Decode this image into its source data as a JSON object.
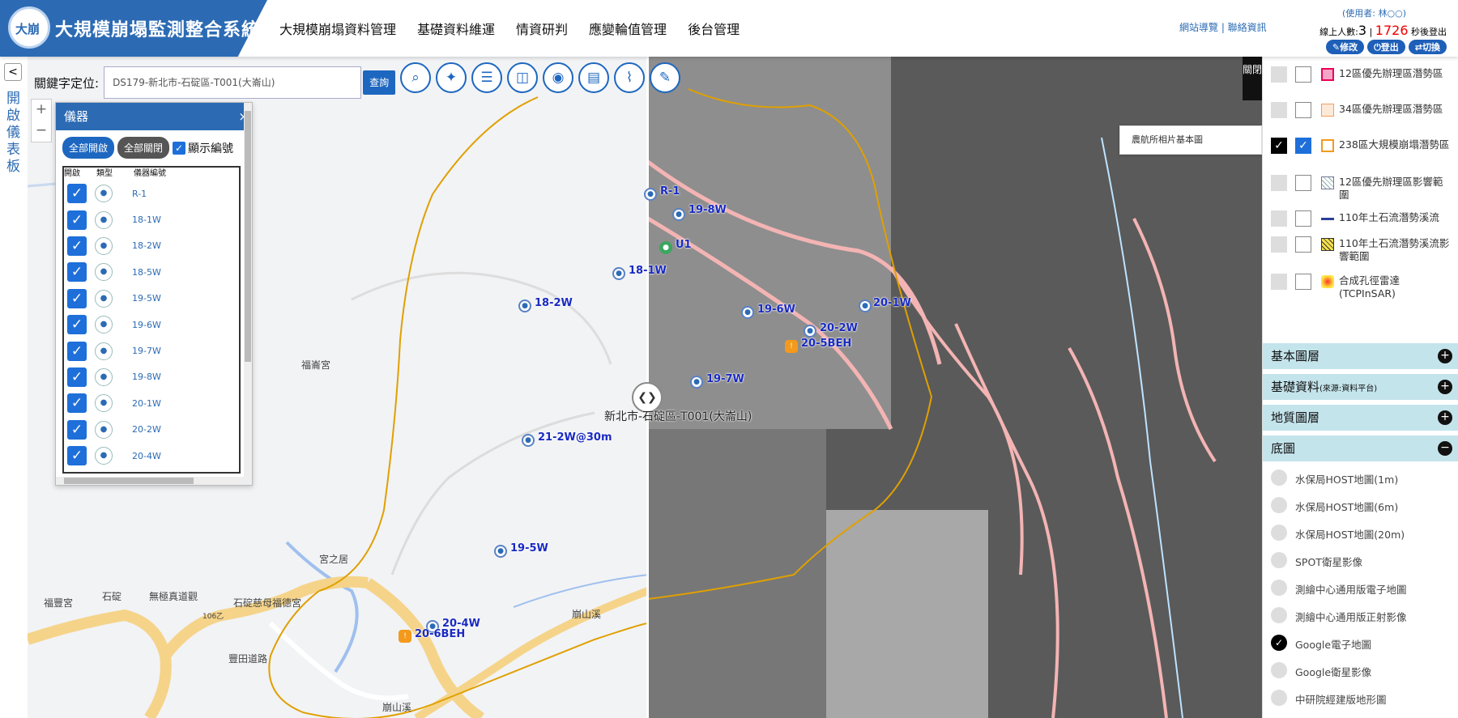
{
  "header": {
    "logo_text": "大崩",
    "title": "大規模崩塌監測整合系統",
    "nav": [
      "大規模崩塌資料管理",
      "基礎資料維運",
      "情資研判",
      "應變輪值管理",
      "後台管理"
    ],
    "links": "網站導覽 | 聯絡資訊",
    "user": "(使用者: 林○○)",
    "online_label": "線上人數:",
    "online_count": "3",
    "countdown": "1726",
    "countdown_suffix": "秒後登出",
    "buttons": [
      "✎修改",
      "⏻登出",
      "⇄切換"
    ]
  },
  "left_strip": {
    "collapse": "<",
    "open_panel": "開啟儀表板"
  },
  "search": {
    "label": "關鍵字定位:",
    "value": "DS179-新北市-石碇區-T001(大崙山)",
    "button": "查詢"
  },
  "toolbar": [
    "search-zoom",
    "satellite",
    "list",
    "layout",
    "camera",
    "map-print",
    "ruler",
    "edit"
  ],
  "zoom": {
    "in": "+",
    "out": "−"
  },
  "instruments": {
    "title": "儀器",
    "close": "×",
    "open_all": "全部開啟",
    "close_all": "全部關閉",
    "show_id": "顯示編號",
    "col_toggle": "開啟",
    "col_type": "類型",
    "col_id": "儀器編號",
    "rows": [
      "R-1",
      "18-1W",
      "18-2W",
      "18-5W",
      "19-5W",
      "19-6W",
      "19-7W",
      "19-8W",
      "20-1W",
      "20-2W",
      "20-4W"
    ]
  },
  "basemap_select": "農航所相片基本圖",
  "close_panel": "關閉",
  "layers": [
    {
      "label": "12區優先辦理區潛勢區",
      "on": false,
      "sym": "pinkbox"
    },
    {
      "label": "34區優先辦理區潛勢區",
      "on": false,
      "sym": "orangebox"
    },
    {
      "label": "238區大規模崩塌潛勢區",
      "on": true,
      "sym": "orangeline"
    },
    {
      "label": "12區優先辦理區影響範圍",
      "on": false,
      "sym": "hatch"
    },
    {
      "label": "110年土石流潛勢溪流",
      "on": false,
      "sym": "blueline"
    },
    {
      "label": "110年土石流潛勢溪流影響範圍",
      "on": false,
      "sym": "yellowhatch"
    },
    {
      "label": "合成孔徑雷達(TCPInSAR)",
      "on": false,
      "sym": "gradient"
    }
  ],
  "sections": {
    "basic": "基本圖層",
    "base_data": "基礎資料",
    "base_data_note": "(來源:資料平台)",
    "geology": "地質圖層",
    "basemap": "底圖"
  },
  "basemaps": [
    {
      "label": "水保局HOST地圖(1m)",
      "on": false
    },
    {
      "label": "水保局HOST地圖(6m)",
      "on": false
    },
    {
      "label": "水保局HOST地圖(20m)",
      "on": false
    },
    {
      "label": "SPOT衛星影像",
      "on": false
    },
    {
      "label": "測繪中心通用版電子地圖",
      "on": false
    },
    {
      "label": "測繪中心通用版正射影像",
      "on": false
    },
    {
      "label": "Google電子地圖",
      "on": true
    },
    {
      "label": "Google衛星影像",
      "on": false
    },
    {
      "label": "中研院經建版地形圖",
      "on": false
    }
  ],
  "map_labels": {
    "site": "新北市-石碇區-T001(大崙山)",
    "inst": [
      "R-1",
      "19-8W",
      "U1",
      "18-1W",
      "18-2W",
      "19-6W",
      "20-1W",
      "20-2W",
      "20-5BEH",
      "19-7W",
      "21-2W@30m",
      "19-5W",
      "20-4W",
      "20-6BEH"
    ],
    "places": [
      "福崙宮",
      "宮之居",
      "石碇",
      "無極真道觀",
      "石碇慈母福德宮",
      "福豐宮",
      "豐田道路",
      "崩山溪",
      "崩山溪",
      "106乙"
    ]
  }
}
